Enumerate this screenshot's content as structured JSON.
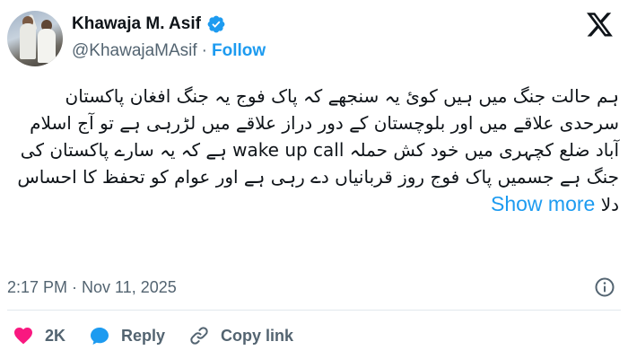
{
  "author": {
    "display_name": "Khawaja M. Asif",
    "handle": "@KhawajaMAsif",
    "separator": "·",
    "follow_label": "Follow"
  },
  "tweet": {
    "text": "ہم حالت جنگ میں ہیں کوئ یہ سنجھے کہ پاک فوج یہ جنگ افغان پاکستان سرحدی علاقے میں اور بلوچستان کے دور دراز علاقے میں لڑرہی ہے تو آج اسلام آباد ضلع کچہری میں خود کش حملہ wake up call ہے کہ یہ سارے پاکستان کی جنگ ہے جسمیں پاک فوج روز قربانیاں دے رہی ہے اور عوام کو تحفظ کا احساس دلا",
    "show_more_label": "Show more"
  },
  "meta": {
    "timestamp": "2:17 PM · Nov 11, 2025"
  },
  "actions": {
    "likes_count": "2K",
    "reply_label": "Reply",
    "copy_link_label": "Copy link"
  },
  "colors": {
    "accent": "#1d9bf0",
    "like": "#f91880",
    "muted": "#536471",
    "text": "#0f1419"
  },
  "icons": [
    "verified-badge-icon",
    "x-logo-icon",
    "info-icon",
    "heart-icon",
    "reply-bubble-icon",
    "link-icon"
  ]
}
